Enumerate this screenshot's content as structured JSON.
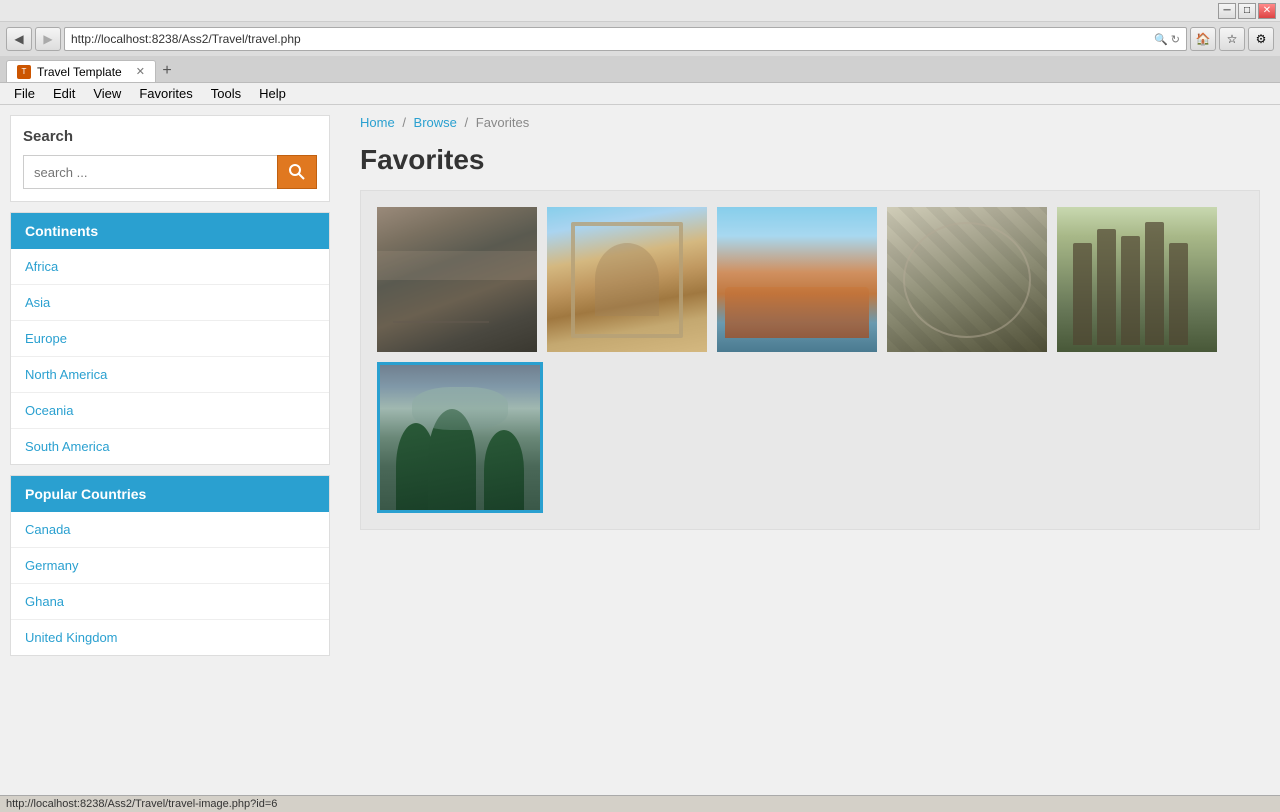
{
  "browser": {
    "url": "http://localhost:8238/Ass2/Travel/travel.php",
    "tab_title": "Travel Template",
    "tab_favicon": "T",
    "titlebar_buttons": [
      "minimize",
      "maximize",
      "close"
    ],
    "menu_items": [
      "File",
      "Edit",
      "View",
      "Favorites",
      "Tools",
      "Help"
    ]
  },
  "sidebar": {
    "search": {
      "title": "Search",
      "placeholder": "search ...",
      "button_icon": "🔍"
    },
    "continents": {
      "header": "Continents",
      "items": [
        {
          "label": "Africa"
        },
        {
          "label": "Asia"
        },
        {
          "label": "Europe"
        },
        {
          "label": "North America"
        },
        {
          "label": "Oceania"
        },
        {
          "label": "South America"
        }
      ]
    },
    "popular_countries": {
      "header": "Popular Countries",
      "items": [
        {
          "label": "Canada"
        },
        {
          "label": "Germany"
        },
        {
          "label": "Ghana"
        },
        {
          "label": "United Kingdom"
        }
      ]
    }
  },
  "main": {
    "breadcrumb": {
      "home": "Home",
      "browse": "Browse",
      "current": "Favorites"
    },
    "page_title": "Favorites",
    "gallery": {
      "images": [
        {
          "id": 1,
          "alt": "City aerial view"
        },
        {
          "id": 2,
          "alt": "Roman arch architecture"
        },
        {
          "id": 3,
          "alt": "Colorful waterfront houses"
        },
        {
          "id": 4,
          "alt": "Glass dome interior"
        },
        {
          "id": 5,
          "alt": "Ancient Greek columns"
        },
        {
          "id": 6,
          "alt": "Mountain landscape with trees",
          "selected": true
        }
      ]
    }
  },
  "status_bar": {
    "url": "http://localhost:8238/Ass2/Travel/travel-image.php?id=6"
  },
  "taskbar": {
    "buttons": [
      {
        "label": "Travel Template",
        "favicon": "T"
      }
    ]
  }
}
